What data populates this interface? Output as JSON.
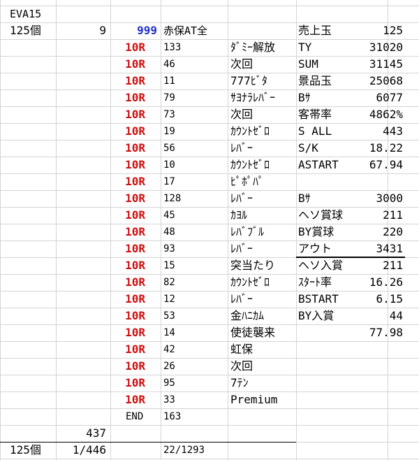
{
  "header": {
    "title": "EVA15"
  },
  "summary_top": {
    "count_label": "125個",
    "count_num": "9",
    "mode_code": "999",
    "mode_name": "赤保AT全"
  },
  "rounds": [
    {
      "r": "10R",
      "n": "133",
      "note": "ﾀﾞﾐｰ解放"
    },
    {
      "r": "10R",
      "n": "46",
      "note": "次回"
    },
    {
      "r": "10R",
      "n": "11",
      "note": "777ﾋﾞﾀ"
    },
    {
      "r": "10R",
      "n": "79",
      "note": "ｻﾖﾅﾗﾚﾊﾞｰ"
    },
    {
      "r": "10R",
      "n": "73",
      "note": "次回"
    },
    {
      "r": "10R",
      "n": "19",
      "note": "ｶｳﾝﾄｾﾞﾛ"
    },
    {
      "r": "10R",
      "n": "56",
      "note": "ﾚﾊﾞｰ"
    },
    {
      "r": "10R",
      "n": "10",
      "note": "ｶｳﾝﾄｾﾞﾛ"
    },
    {
      "r": "10R",
      "n": "17",
      "note": "ﾋﾟﾎﾟﾊﾟ"
    },
    {
      "r": "10R",
      "n": "128",
      "note": "ﾚﾊﾞｰ"
    },
    {
      "r": "10R",
      "n": "45",
      "note": "ｶﾖﾙ"
    },
    {
      "r": "10R",
      "n": "48",
      "note": "ﾚﾊﾞﾌﾞﾙ"
    },
    {
      "r": "10R",
      "n": "93",
      "note": "ﾚﾊﾞｰ"
    },
    {
      "r": "10R",
      "n": "15",
      "note": "突当たり"
    },
    {
      "r": "10R",
      "n": "82",
      "note": "ｶｳﾝﾄｾﾞﾛ"
    },
    {
      "r": "10R",
      "n": "12",
      "note": "ﾚﾊﾞｰ"
    },
    {
      "r": "10R",
      "n": "53",
      "note": "金ﾊﾆｶﾑ"
    },
    {
      "r": "10R",
      "n": "14",
      "note": "使徒襲来"
    },
    {
      "r": "10R",
      "n": "42",
      "note": "虹保"
    },
    {
      "r": "10R",
      "n": "26",
      "note": "次回"
    },
    {
      "r": "10R",
      "n": "95",
      "note": "7ﾃﾝ"
    },
    {
      "r": "10R",
      "n": "33",
      "note": "Premium"
    }
  ],
  "end_row": {
    "label": "END",
    "value": "163"
  },
  "total_row": {
    "value": "437"
  },
  "footer": {
    "count_label": "125個",
    "ratio": "1/446",
    "hits": "22/1293"
  },
  "stats": [
    {
      "label": "売上玉",
      "value": "125"
    },
    {
      "label": "TY",
      "value": "31020"
    },
    {
      "label": "SUM",
      "value": "31145"
    },
    {
      "label": "景品玉",
      "value": "25068"
    },
    {
      "label": "Bｻ",
      "value": "6077"
    },
    {
      "label": "客帯率",
      "value": "4862%"
    },
    {
      "label": "S ALL",
      "value": "443"
    },
    {
      "label": "S/K",
      "value": "18.22"
    },
    {
      "label": "ASTART",
      "value": "67.94"
    },
    {
      "label": "",
      "value": ""
    },
    {
      "label": "Bｻ",
      "value": "3000"
    },
    {
      "label": "ヘソ賞球",
      "value": "211"
    },
    {
      "label": "BY賞球",
      "value": "220"
    },
    {
      "label": "アウト",
      "value": "3431"
    },
    {
      "label": "ヘソ入賞",
      "value": "211"
    },
    {
      "label": "ｽﾀｰﾄ率",
      "value": "16.26"
    },
    {
      "label": "BSTART",
      "value": "6.15"
    },
    {
      "label": "BY入賞",
      "value": "44"
    },
    {
      "label": "",
      "value": "77.98"
    }
  ]
}
